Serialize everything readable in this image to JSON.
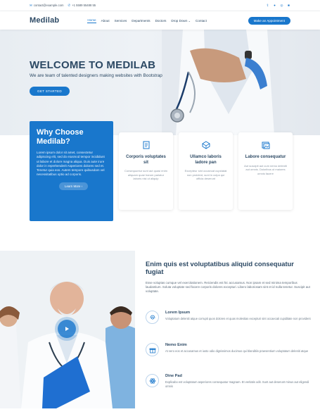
{
  "topbar": {
    "email": "contact@example.com",
    "phone": "+1 5589 55488 55",
    "social_icons": [
      "twitter-icon",
      "facebook-icon",
      "instagram-icon",
      "linkedin-icon"
    ]
  },
  "header": {
    "logo": "Medilab",
    "nav": [
      {
        "label": "Home",
        "active": true
      },
      {
        "label": "About"
      },
      {
        "label": "Services"
      },
      {
        "label": "Departments"
      },
      {
        "label": "Doctors"
      },
      {
        "label": "Drop Down"
      },
      {
        "label": "Contact"
      }
    ],
    "appointment_label": "Make an Appointment"
  },
  "hero": {
    "title": "WELCOME TO MEDILAB",
    "subtitle": "We are team of talented designers making websites with Bootstrap",
    "cta": "GET STARTED"
  },
  "why": {
    "title": "Why Choose Medilab?",
    "text": "Lorem ipsum dolor sit amet, consectetur adipiscing elit, sed do eiusmod tempor incididunt ut labore et dolore magna aliqua. Duis aute irure dolor in reprehenderit Asperiores dolores sed et. Tenetur quia eos. Autem tempore quibusdam vel necessitatibus optio ad corporis.",
    "button": "Learn More"
  },
  "cards": [
    {
      "icon": "receipt-icon",
      "title": "Corporis voluptates sit",
      "text": "Consequuntur sunt aut quasi enim aliquam quae harum pariatur laboris nisi ut aliquip"
    },
    {
      "icon": "cube-icon",
      "title": "Ullamco laboris ladore pan",
      "text": "Excepteur sint occaecat cupidatat non proident, sunt in culpa qui officia deserunt"
    },
    {
      "icon": "images-icon",
      "title": "Labore consequatur",
      "text": "Aut suscipit aut cum nemo deleniti aut omnis. Doloribus ut maiores omnis facere"
    }
  ],
  "about": {
    "title": "Enim quis est voluptatibus aliquid consequatur fugiat",
    "text": "Esse voluptas cumque vel exercitationem. Reiciendis est hic accusamus. Non ipsam et sed minima temporibus laudantium. Soluta voluptate sed facere corporis dolores excepturi. Libero laboriosam sint et id nulla tenetur. Suscipit aut voluptate.",
    "features": [
      {
        "icon": "fingerprint-icon",
        "title": "Lorem Ipsum",
        "text": "Voluptatum deleniti atque corrupti quos dolores et quas molestias excepturi sint occaecati cupiditate non provident"
      },
      {
        "icon": "gift-icon",
        "title": "Nemo Enim",
        "text": "At vero eos et accusamus et iusto odio dignissimos ducimus qui blanditiis praesentium voluptatum deleniti atque"
      },
      {
        "icon": "atom-icon",
        "title": "Dine Pad",
        "text": "Explicabo est voluptatum asperiores consequatur magnam. Et veritatis odit. Sunt aut deserunt minus aut eligendi omnis"
      }
    ]
  },
  "colors": {
    "accent": "#1977cc",
    "heading": "#2c4964"
  }
}
